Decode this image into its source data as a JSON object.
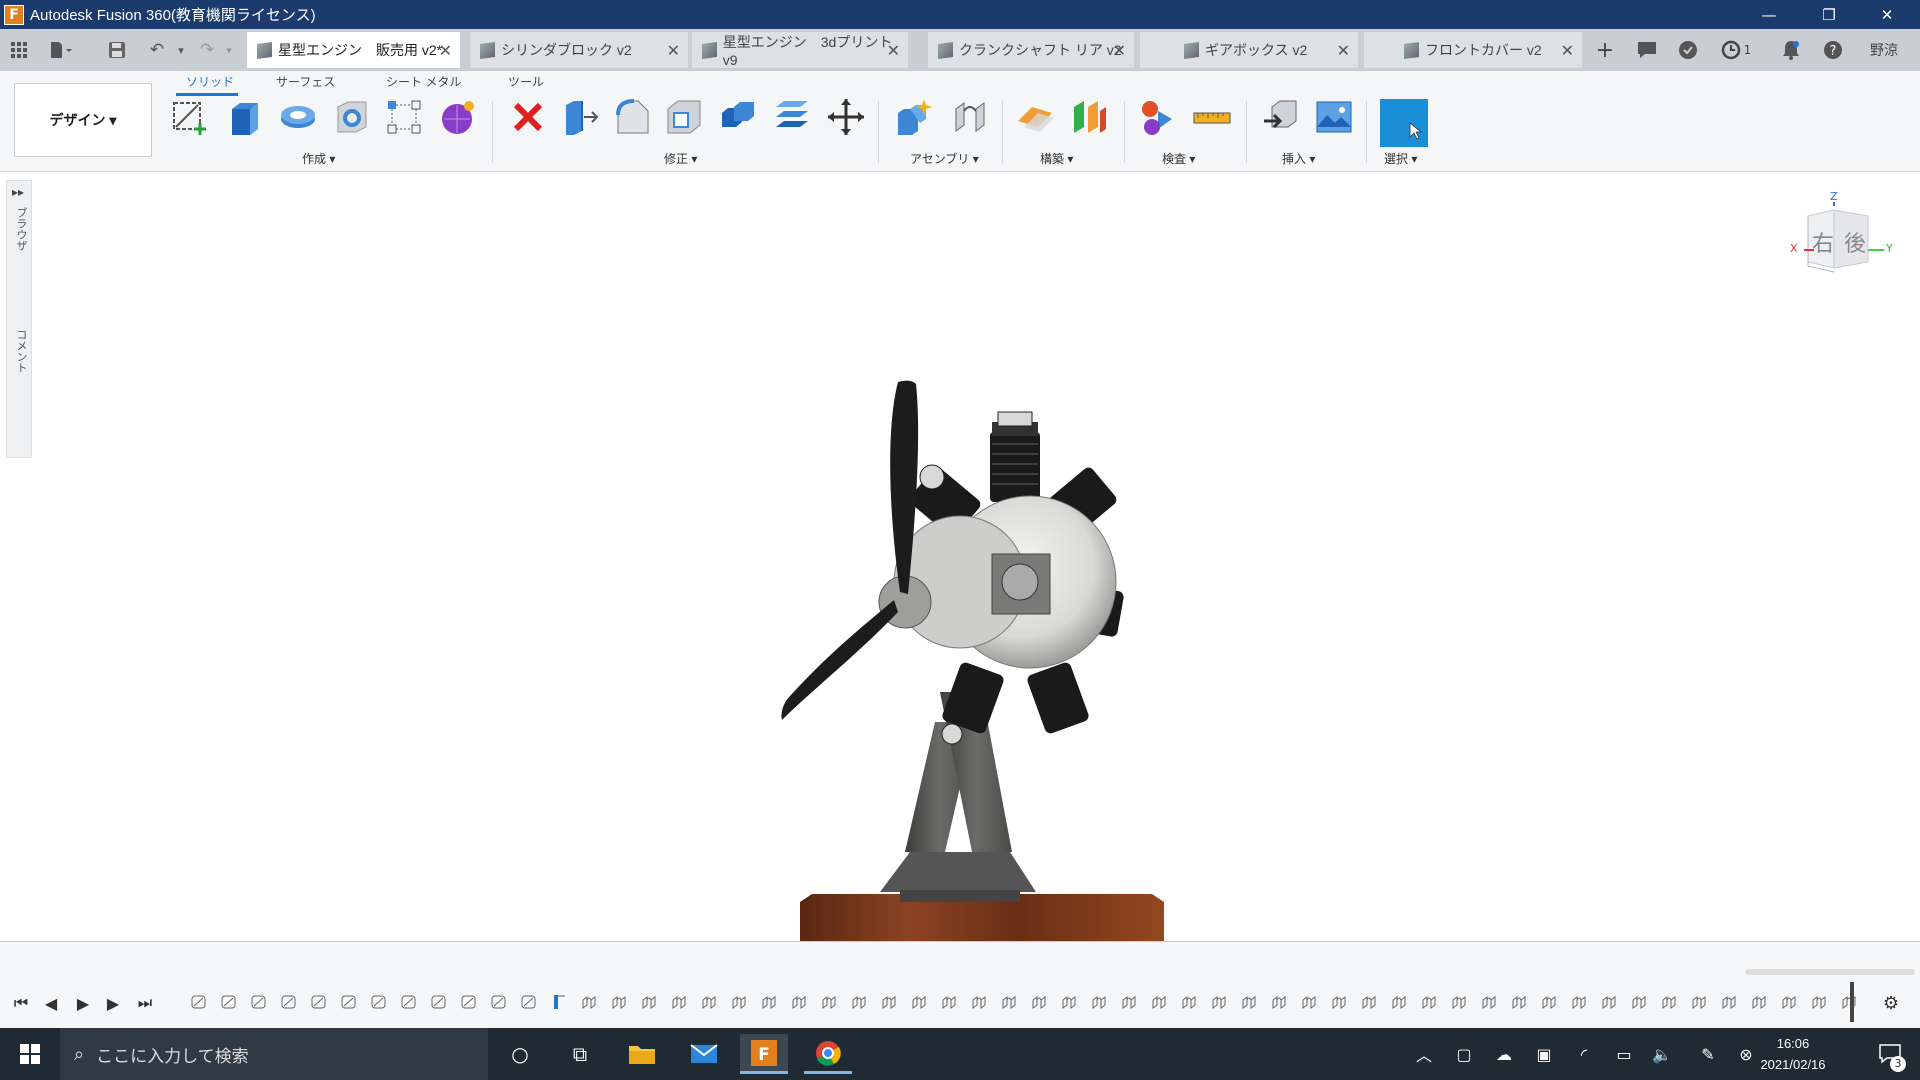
{
  "window": {
    "title": "Autodesk Fusion 360(教育機関ライセンス)",
    "logo_letter": "F"
  },
  "tabs": [
    {
      "label": "星型エンジン　販売用 v2*",
      "active": true
    },
    {
      "label": "シリンダブロック v2",
      "active": false
    },
    {
      "label": "星型エンジン　3dプリント v9",
      "active": false
    },
    {
      "label": "クランクシャフト リア v2",
      "active": false
    },
    {
      "label": "ギアボックス v2",
      "active": false
    },
    {
      "label": "フロントカバー v2",
      "active": false
    }
  ],
  "header": {
    "job_count": "1",
    "user_initials": "野涼"
  },
  "toolbar": {
    "workspace_label": "デザイン ▾",
    "ribbon_tabs": [
      "ソリッド",
      "サーフェス",
      "シート メタル",
      "ツール"
    ],
    "groups": {
      "create": "作成 ▾",
      "modify": "修正 ▾",
      "assemble": "アセンブリ ▾",
      "construct": "構築 ▾",
      "inspect": "検査 ▾",
      "insert": "挿入 ▾",
      "select": "選択 ▾"
    }
  },
  "side_panel": {
    "browser_label": "ブラウザ",
    "comments_label": "コメント"
  },
  "viewcube": {
    "face_right": "右",
    "face_back": "後",
    "axis_x": "X",
    "axis_y": "Y",
    "axis_z": "Z"
  },
  "taskbar": {
    "search_placeholder": "ここに入力して検索",
    "time": "16:06",
    "date": "2021/02/16",
    "notification_count": "3"
  },
  "colors": {
    "accent": "#1e78d0",
    "title_bar": "#1b3b6e",
    "taskbar": "#1f2a33"
  }
}
